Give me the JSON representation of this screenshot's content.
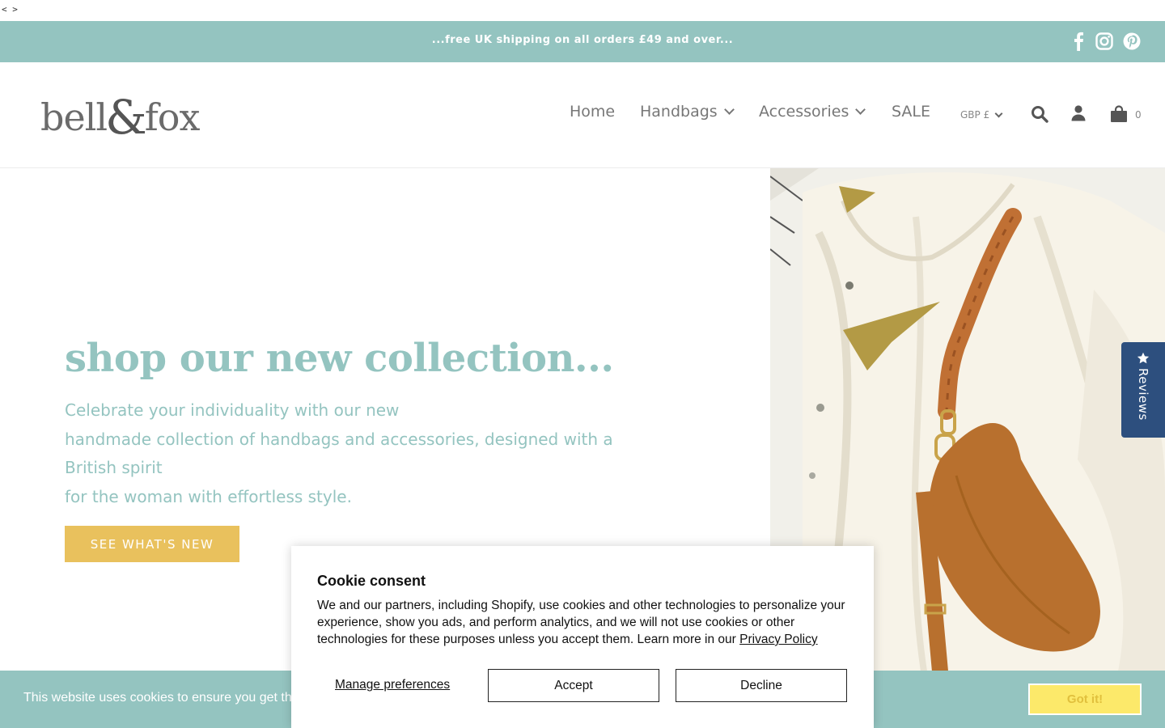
{
  "page_code": "< >",
  "announcement": {
    "text": "...free UK shipping on all orders £49 and over...",
    "social": [
      "facebook-icon",
      "instagram-icon",
      "pinterest-icon"
    ]
  },
  "header": {
    "logo_left": "bell",
    "logo_amp": "&",
    "logo_right": "fox",
    "nav": [
      {
        "label": "Home",
        "has_dropdown": false
      },
      {
        "label": "Handbags",
        "has_dropdown": true
      },
      {
        "label": "Accessories",
        "has_dropdown": true
      },
      {
        "label": "SALE",
        "has_dropdown": false
      }
    ],
    "currency": "GBP £",
    "cart_count": "0"
  },
  "hero": {
    "title": "shop our new collection...",
    "lines": [
      "Celebrate your individuality with our new",
      "handmade collection of handbags and accessories, designed with a British spirit",
      "for the woman with effortless style."
    ],
    "button": "SEE WHAT'S NEW"
  },
  "reviews_tab": {
    "label": "Reviews"
  },
  "cookie_bar": {
    "text": "This website uses cookies to ensure you get the best experience on our website.",
    "button": "Got it!"
  },
  "consent": {
    "title": "Cookie consent",
    "body": "We and our partners, including Shopify, use cookies and other technologies to personalize your experience, show you ads, and perform analytics, and we will not use cookies or other technologies for these purposes unless you accept them. Learn more in our",
    "link": "Privacy Policy",
    "manage": "Manage preferences",
    "accept": "Accept",
    "decline": "Decline"
  },
  "colors": {
    "teal": "#94c4c0",
    "mustard": "#e9c15d",
    "navy": "#2d4f7e",
    "yellow": "#fce96a"
  }
}
